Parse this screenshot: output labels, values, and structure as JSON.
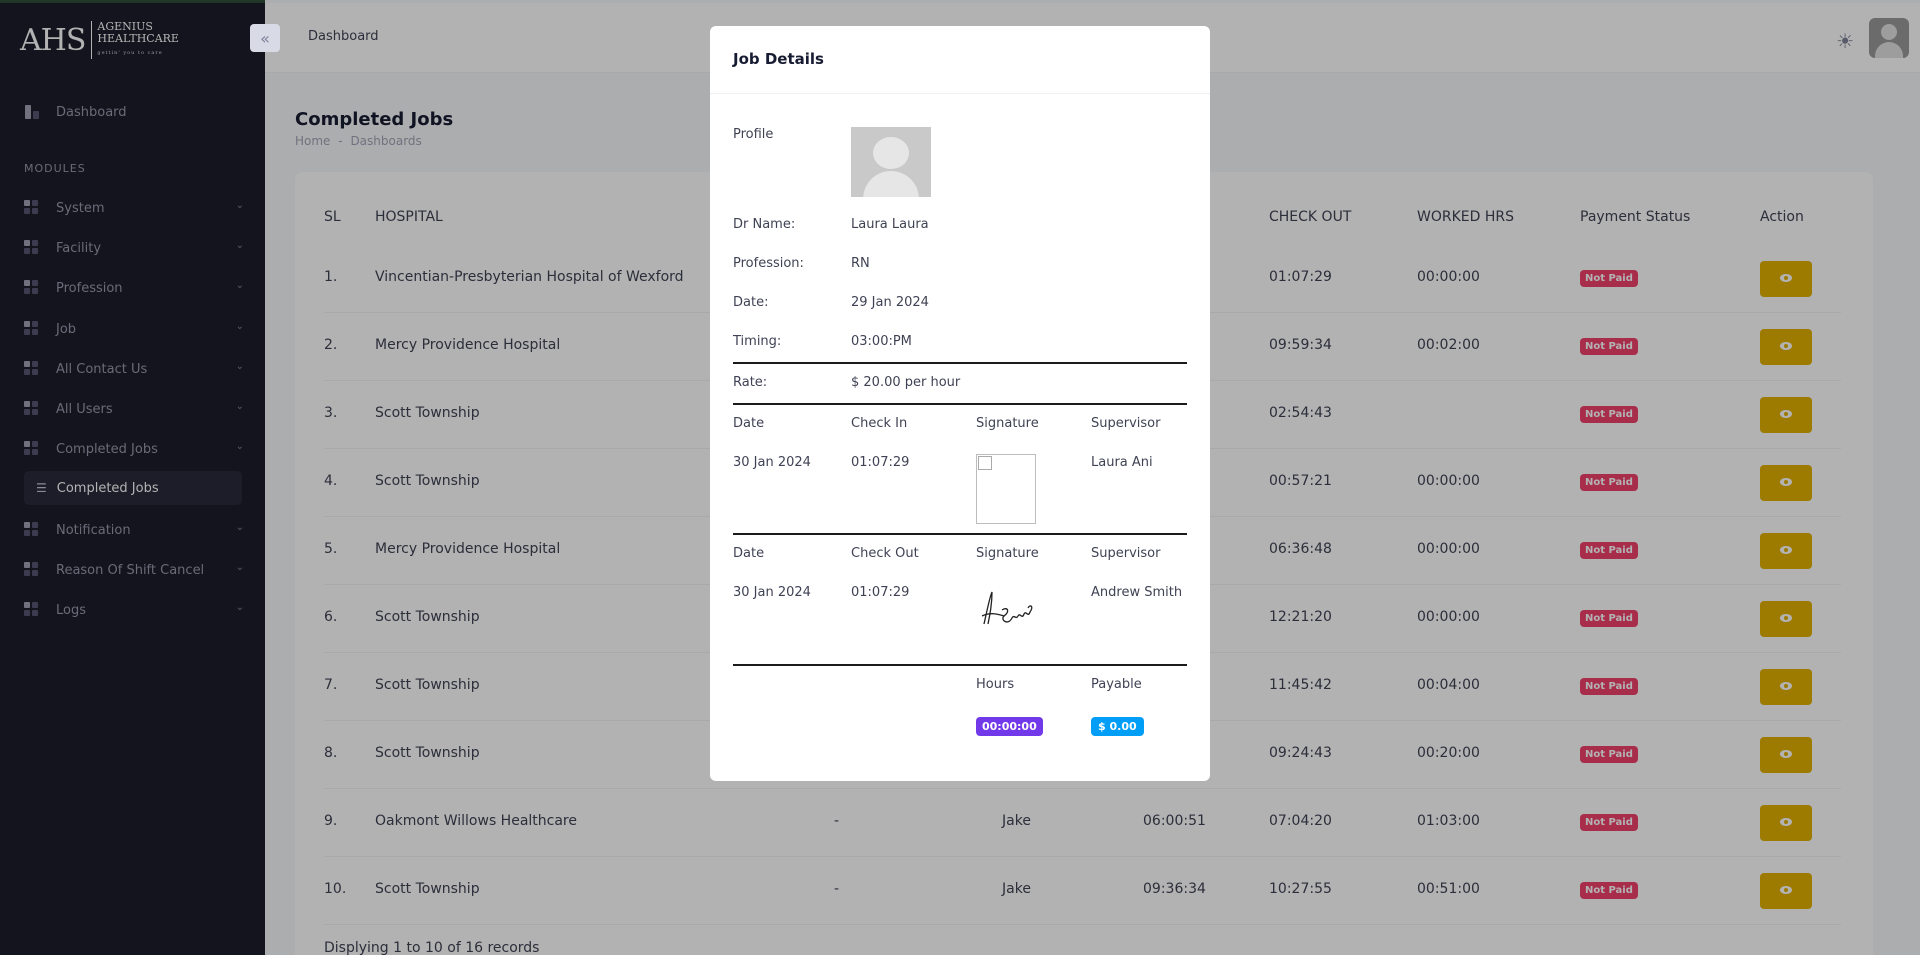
{
  "brand": {
    "mark": "AHS",
    "name_line1": "AGENIUS",
    "name_line2": "HEALTHCARE",
    "tagline": "gettin' you to care"
  },
  "sidebar": {
    "dashboard": "Dashboard",
    "section": "MODULES",
    "items": [
      "System",
      "Facility",
      "Profession",
      "Job",
      "All Contact Us",
      "All Users",
      "Completed Jobs"
    ],
    "active_sub": "Completed Jobs",
    "items_after": [
      "Notification",
      "Reason Of Shift Cancel",
      "Logs"
    ]
  },
  "header": {
    "title": "Dashboard",
    "theme_icon": "sun-icon"
  },
  "page": {
    "title": "Completed Jobs",
    "crumb_home": "Home",
    "crumb_sep": "-",
    "crumb_current": "Dashboards"
  },
  "table": {
    "headers": {
      "sl": "SL",
      "hospital": "HOSPITAL",
      "check_out": "CHECK OUT",
      "worked": "WORKED HRS",
      "payment": "Payment Status",
      "action": "Action"
    },
    "rows": [
      {
        "sl": "1.",
        "hospital": "Vincentian-Presbyterian Hospital of Wexford",
        "col3": "",
        "col4": "",
        "check_in": "",
        "check_out": "01:07:29",
        "worked": "00:00:00",
        "status": "Not Paid"
      },
      {
        "sl": "2.",
        "hospital": "Mercy Providence Hospital",
        "col3": "",
        "col4": "",
        "check_in": "",
        "check_out": "09:59:34",
        "worked": "00:02:00",
        "status": "Not Paid"
      },
      {
        "sl": "3.",
        "hospital": "Scott Township",
        "col3": "",
        "col4": "",
        "check_in": "",
        "check_out": "02:54:43",
        "worked": "",
        "status": "Not Paid"
      },
      {
        "sl": "4.",
        "hospital": "Scott Township",
        "col3": "",
        "col4": "",
        "check_in": "",
        "check_out": "00:57:21",
        "worked": "00:00:00",
        "status": "Not Paid"
      },
      {
        "sl": "5.",
        "hospital": "Mercy Providence Hospital",
        "col3": "",
        "col4": "",
        "check_in": "",
        "check_out": "06:36:48",
        "worked": "00:00:00",
        "status": "Not Paid"
      },
      {
        "sl": "6.",
        "hospital": "Scott Township",
        "col3": "",
        "col4": "",
        "check_in": "",
        "check_out": "12:21:20",
        "worked": "00:00:00",
        "status": "Not Paid"
      },
      {
        "sl": "7.",
        "hospital": "Scott Township",
        "col3": "",
        "col4": "",
        "check_in": "",
        "check_out": "11:45:42",
        "worked": "00:04:00",
        "status": "Not Paid"
      },
      {
        "sl": "8.",
        "hospital": "Scott Township",
        "col3": "",
        "col4": "",
        "check_in": "",
        "check_out": "09:24:43",
        "worked": "00:20:00",
        "status": "Not Paid"
      },
      {
        "sl": "9.",
        "hospital": "Oakmont Willows Healthcare",
        "col3": "-",
        "col4": "Jake",
        "check_in": "06:00:51",
        "check_out": "07:04:20",
        "worked": "01:03:00",
        "status": "Not Paid"
      },
      {
        "sl": "10.",
        "hospital": "Scott Township",
        "col3": "-",
        "col4": "Jake",
        "check_in": "09:36:34",
        "check_out": "10:27:55",
        "worked": "00:51:00",
        "status": "Not Paid"
      }
    ],
    "footer": "Displying 1 to 10 of 16 records"
  },
  "modal": {
    "title": "Job Details",
    "profile_label": "Profile",
    "fields": [
      {
        "label": "Dr Name:",
        "value": "Laura Laura"
      },
      {
        "label": "Profession:",
        "value": "RN"
      },
      {
        "label": "Date:",
        "value": "29 Jan 2024"
      },
      {
        "label": "Timing:",
        "value": "03:00:PM"
      }
    ],
    "rate_label": "Rate:",
    "rate_value": "$ 20.00 per hour",
    "checkin": {
      "h_date": "Date",
      "h_time": "Check In",
      "h_sig": "Signature",
      "h_sup": "Supervisor",
      "date": "30 Jan 2024",
      "time": "01:07:29",
      "supervisor": "Laura Ani"
    },
    "checkout": {
      "h_date": "Date",
      "h_time": "Check Out",
      "h_sig": "Signature",
      "h_sup": "Supervisor",
      "date": "30 Jan 2024",
      "time": "01:07:29",
      "supervisor": "Andrew Smith"
    },
    "summary": {
      "h_hours": "Hours",
      "h_payable": "Payable",
      "hours": "00:00:00",
      "payable": "$ 0.00"
    }
  },
  "colors": {
    "sidebar": "#1e1e2d",
    "not_paid": "#f1416c",
    "action": "#e0b100",
    "hours_badge": "#7239ea",
    "pay_badge": "#009ef7"
  }
}
